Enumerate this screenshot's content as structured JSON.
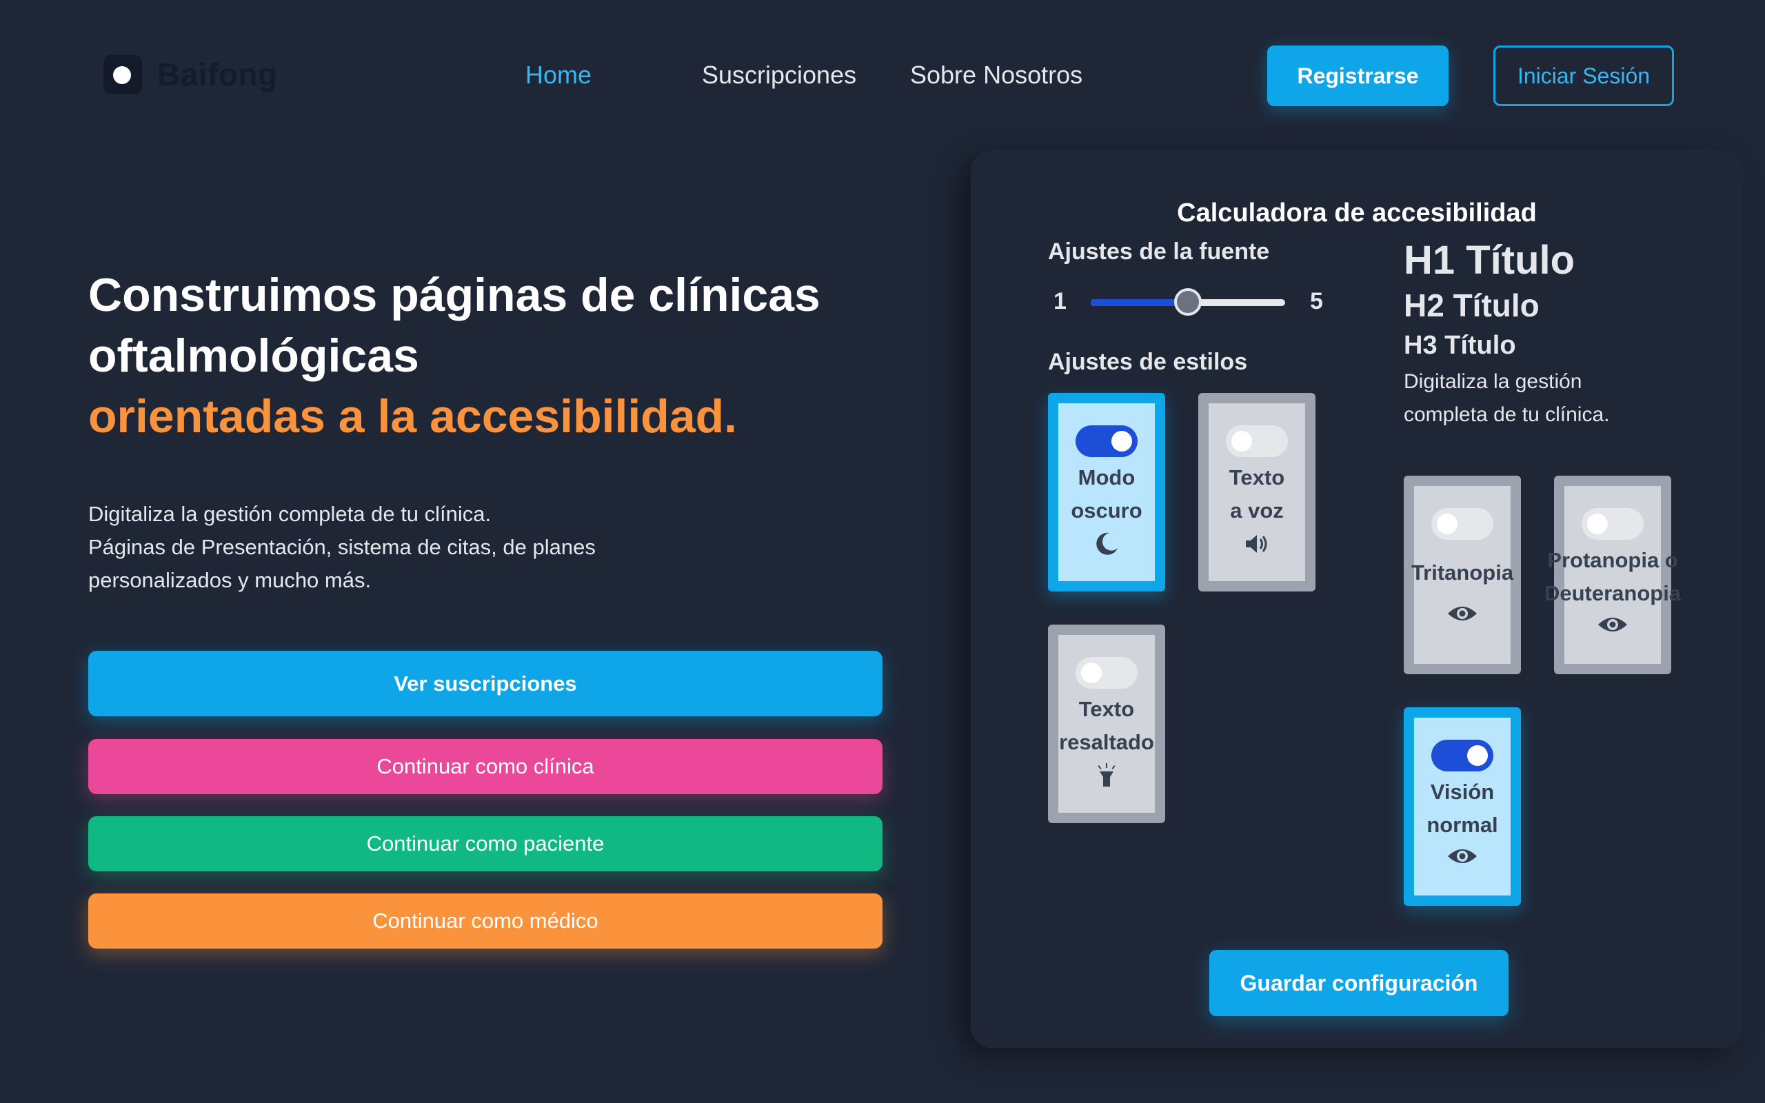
{
  "header": {
    "logo_text": "Baifong",
    "nav": {
      "home": "Home",
      "subscriptions": "Suscripciones",
      "about": "Sobre Nosotros"
    },
    "register_label": "Registrarse",
    "login_label": "Iniciar Sesión"
  },
  "hero": {
    "title_line1": "Construimos páginas de clínicas oftalmológicas",
    "title_accent": "orientadas a la accesibilidad.",
    "description_lines": [
      "Digitaliza la gestión completa de tu clínica.",
      "Páginas de Presentación, sistema de citas, de planes personalizados y mucho más."
    ],
    "buttons": {
      "subscriptions": "Ver suscripciones",
      "clinic": "Continuar como clínica",
      "patient": "Continuar como paciente",
      "doctor": "Continuar como médico"
    }
  },
  "calculator": {
    "title": "Calculadora de accesibilidad",
    "font_section": "Ajustes de la fuente",
    "slider": {
      "min": "1",
      "max": "5",
      "value": 3
    },
    "style_section": "Ajustes de estilos",
    "toggles": {
      "dark_mode": {
        "label_line1": "Modo",
        "label_line2": "oscuro",
        "on": true,
        "icon": "moon-icon"
      },
      "text_to_speech": {
        "label_line1": "Texto",
        "label_line2": "a voz",
        "on": false,
        "icon": "speaker-icon"
      },
      "highlight_text": {
        "label_line1": "Texto",
        "label_line2": "resaltado",
        "on": false,
        "icon": "flashlight-icon"
      },
      "tritanopia": {
        "label_line1": "Tritanopia",
        "label_line2": "",
        "on": false,
        "icon": "eye-icon"
      },
      "protanopia": {
        "label_line1": "Protanopia o",
        "label_line2": "Deuteranopia",
        "on": false,
        "icon": "eye-icon"
      },
      "normal_vision": {
        "label_line1": "Visión",
        "label_line2": "normal",
        "on": true,
        "icon": "eye-icon"
      }
    },
    "preview": {
      "h1": "H1 Título",
      "h2": "H2 Título",
      "h3": "H3 Título",
      "paragraph": "Digitaliza la gestión completa de tu clínica."
    },
    "save_label": "Guardar configuración"
  },
  "colors": {
    "background": "#1f2737",
    "primary": "#0ea5e9",
    "accent_orange": "#fb923c",
    "pink": "#ec4899",
    "green": "#10b981",
    "toggle_on": "#1d4ed8"
  }
}
